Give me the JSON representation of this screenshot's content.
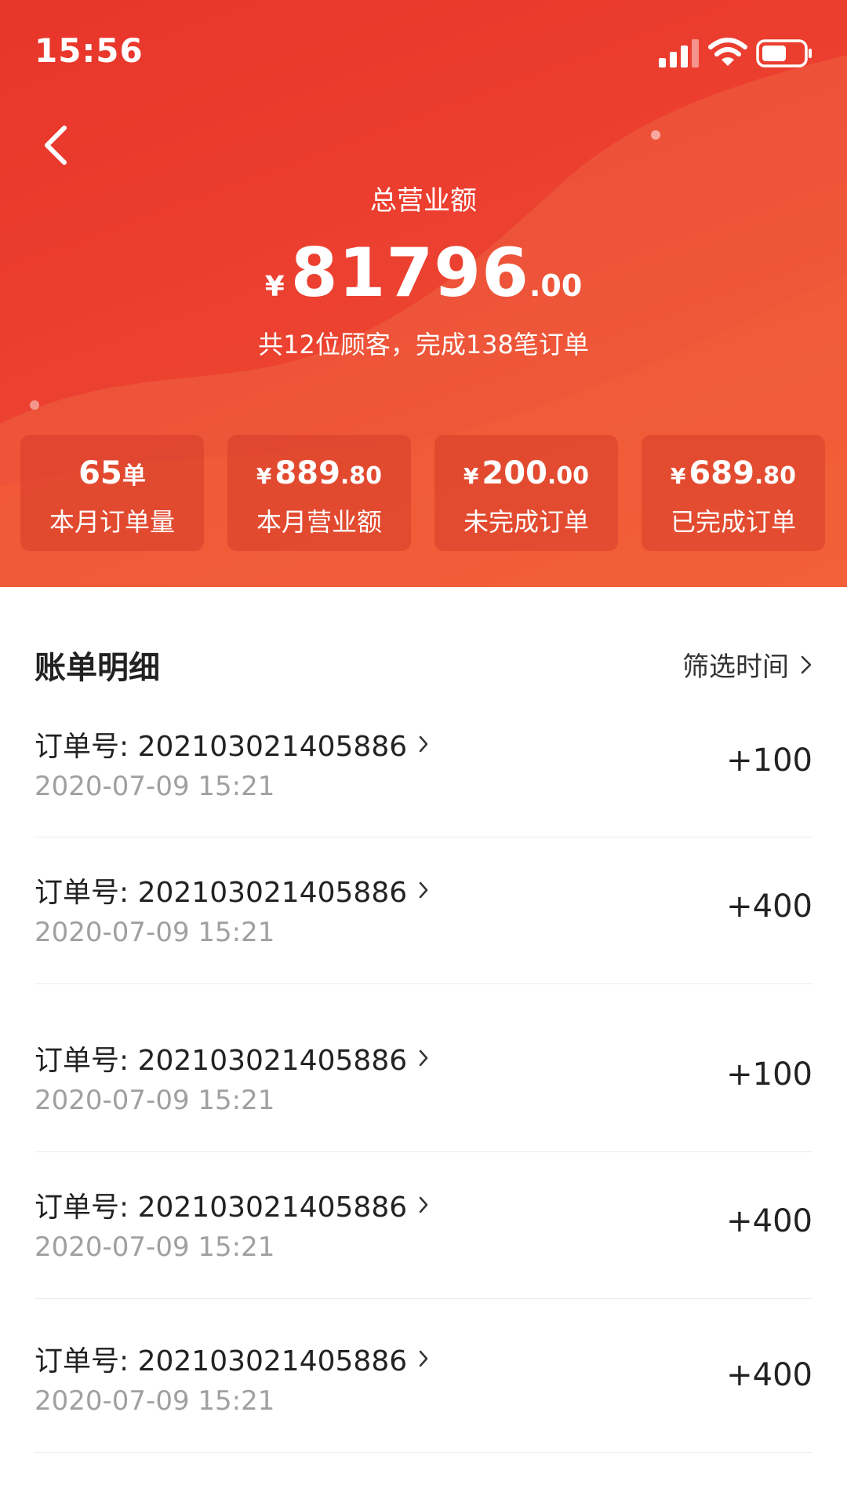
{
  "status_bar": {
    "time": "15:56",
    "signal_icon": "signal-icon",
    "wifi_icon": "wifi-icon",
    "battery_icon": "battery-icon"
  },
  "nav": {
    "back_icon": "chevron-left-icon"
  },
  "summary": {
    "label": "总营业额",
    "currency": "¥",
    "amount_int": "81796",
    "amount_dec": ".00",
    "description": "共12位顾客，完成138笔订单"
  },
  "stats": [
    {
      "value_main": "65",
      "value_unit": "单",
      "label": "本月订单量"
    },
    {
      "currency": "¥",
      "value_main": "889",
      "value_dec": ".80",
      "label": "本月营业额"
    },
    {
      "currency": "¥",
      "value_main": "200",
      "value_dec": ".00",
      "label": "未完成订单"
    },
    {
      "currency": "¥",
      "value_main": "689",
      "value_dec": ".80",
      "label": "已完成订单"
    }
  ],
  "bills": {
    "title": "账单明细",
    "filter_label": "筛选时间",
    "items": [
      {
        "order": "订单号: 202103021405886",
        "date": "2020-07-09 15:21",
        "amount": "+100"
      },
      {
        "order": "订单号: 202103021405886",
        "date": "2020-07-09 15:21",
        "amount": "+400"
      },
      {
        "order": "订单号: 202103021405886",
        "date": "2020-07-09 15:21",
        "amount": "+100"
      },
      {
        "order": "订单号: 202103021405886",
        "date": "2020-07-09 15:21",
        "amount": "+400"
      },
      {
        "order": "订单号: 202103021405886",
        "date": "2020-07-09 15:21",
        "amount": "+400"
      }
    ]
  },
  "colors": {
    "header_red": "#e8352a",
    "header_orange": "#f2552f",
    "text_primary": "#222222",
    "text_secondary": "#a0a0a0"
  }
}
